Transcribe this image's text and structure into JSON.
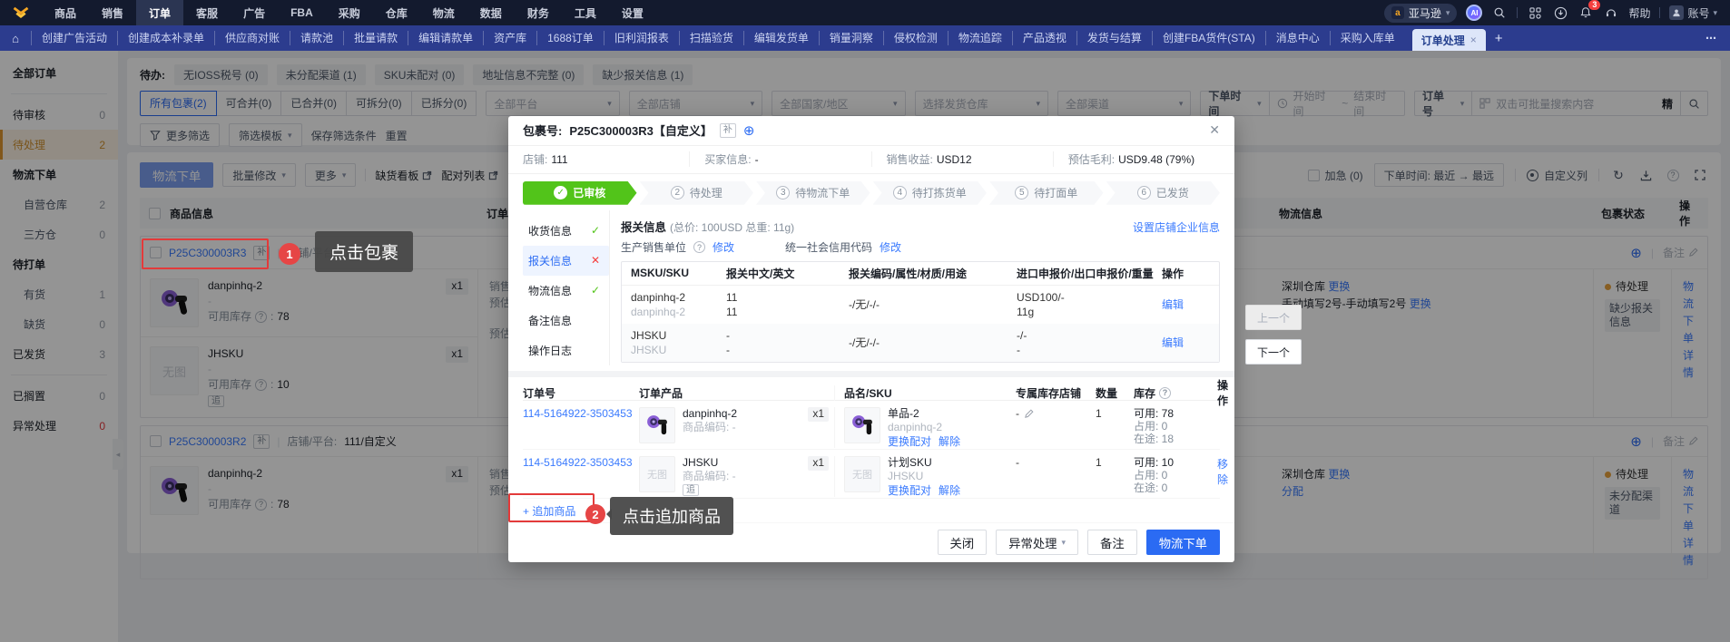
{
  "colors": {
    "accent": "#2b6bf3",
    "nav_dark": "#131a2e",
    "nav_blue": "#2c3c8e",
    "orange": "#e0962e",
    "green": "#52c41a",
    "red": "#e5383b",
    "link": "#3a7afe"
  },
  "topnav": {
    "menus": [
      "商品",
      "销售",
      "订单",
      "客服",
      "广告",
      "FBA",
      "采购",
      "仓库",
      "物流",
      "数据",
      "财务",
      "工具",
      "设置"
    ],
    "marketplace": "亚马逊",
    "ai": "AI",
    "badge": "3",
    "help": "帮助",
    "account": "账号"
  },
  "tabbar": {
    "items": [
      "创建广告活动",
      "创建成本补录单",
      "供应商对账",
      "请款池",
      "批量请款",
      "编辑请款单",
      "资产库",
      "1688订单",
      "旧利润报表",
      "扫描验货",
      "编辑发货单",
      "销量洞察",
      "侵权检测",
      "物流追踪",
      "产品透视",
      "发货与结算",
      "创建FBA货件(STA)",
      "消息中心",
      "采购入库单"
    ],
    "active": "订单处理"
  },
  "sidebar": {
    "all": "全部订单",
    "items": [
      {
        "label": "待审核",
        "count": "0"
      },
      {
        "label": "待处理",
        "count": "2"
      },
      {
        "label": "物流下单",
        "count": ""
      },
      {
        "label": "自营仓库",
        "count": "2"
      },
      {
        "label": "三方仓",
        "count": "0"
      },
      {
        "label": "待打单",
        "count": ""
      },
      {
        "label": "有货",
        "count": "1"
      },
      {
        "label": "缺货",
        "count": "0"
      },
      {
        "label": "已发货",
        "count": "3"
      },
      {
        "label": "已搁置",
        "count": "0"
      },
      {
        "label": "异常处理",
        "count": "0"
      }
    ]
  },
  "filters": {
    "todo_label": "待办:",
    "chips": [
      "无IOSS税号 (0)",
      "未分配渠道 (1)",
      "SKU未配对 (0)",
      "地址信息不完整 (0)",
      "缺少报关信息 (1)"
    ],
    "tabs": [
      "所有包裹(2)",
      "可合并(0)",
      "已合并(0)",
      "可拆分(0)",
      "已拆分(0)"
    ],
    "selects": [
      "全部平台",
      "全部店铺",
      "全部国家/地区",
      "选择发货仓库",
      "全部渠道"
    ],
    "time_field": "下单时间",
    "time_start": "开始时间",
    "time_sep": "~",
    "time_end": "结束时间",
    "search_field": "订单号",
    "search_placeholder": "双击可批量搜索内容",
    "exact": "精",
    "more": "更多筛选",
    "template": "筛选模板",
    "save": "保存筛选条件",
    "reset": "重置"
  },
  "toolbar": {
    "ship": "物流下单",
    "batch": "批量修改",
    "more": "更多",
    "oos": "缺货看板",
    "pair": "配对列表",
    "urgent": "加急 (0)",
    "sort": "下单时间: 最近 → 最远",
    "columns": "自定义列"
  },
  "list": {
    "headers": {
      "product": "商品信息",
      "amount": "订单金",
      "logistics": "物流信息",
      "status": "包裹状态",
      "action": "操作"
    },
    "note": "备注",
    "no_image": "无图",
    "groups": [
      {
        "pkg": "P25C300003R3",
        "tag": "补",
        "store_label": "店铺/平台:",
        "store": "111/自定义",
        "products": [
          {
            "name": "danpinhq-2",
            "sub": "-",
            "stock_label": "可用库存",
            "stock": "78",
            "qty": "x1"
          },
          {
            "name": "JHSKU",
            "sub": "-",
            "stock_label": "可用库存",
            "stock": "10",
            "qty": "x1",
            "tag": "追"
          }
        ],
        "amount_lines": [
          "销售收",
          "预估毛",
          "预估运"
        ],
        "wh": "深圳仓库",
        "wh_link": "更换",
        "channel": "手动填写2号-手动填写2号",
        "channel_link": "更换",
        "status": "待处理",
        "chip": "缺少报关信息",
        "act1": "物流下单",
        "act2": "详情"
      },
      {
        "pkg": "P25C300003R2",
        "tag": "补",
        "store_label": "店铺/平台:",
        "store": "111/自定义",
        "products": [
          {
            "name": "danpinhq-2",
            "sub": "-",
            "stock_label": "可用库存",
            "stock": "78",
            "qty": "x1"
          }
        ],
        "amount_lines": [
          "销售收",
          "预估毛"
        ],
        "wh": "深圳仓库",
        "wh_link": "更换",
        "channel": "",
        "channel_link": "分配",
        "status": "待处理",
        "chip": "未分配渠道",
        "act1": "物流下单",
        "act2": "详情"
      }
    ]
  },
  "modal": {
    "title_label": "包裹号:",
    "title": "P25C300003R3【自定义】",
    "tag": "补",
    "info": [
      {
        "label": "店铺:",
        "value": "111"
      },
      {
        "label": "买家信息:",
        "value": "-"
      },
      {
        "label": "销售收益:",
        "value": "USD12"
      },
      {
        "label": "预估毛利:",
        "value": "USD9.48 (79%)"
      }
    ],
    "steps": [
      {
        "num": "",
        "label": "已审核"
      },
      {
        "num": "2",
        "label": "待处理"
      },
      {
        "num": "3",
        "label": "待物流下单"
      },
      {
        "num": "4",
        "label": "待打拣货单"
      },
      {
        "num": "5",
        "label": "待打面单"
      },
      {
        "num": "6",
        "label": "已发货"
      }
    ],
    "tabs": [
      "收货信息",
      "报关信息",
      "物流信息",
      "备注信息",
      "操作日志"
    ],
    "customs": {
      "title": "报关信息",
      "meta": "(总价: 100USD 总重: 11g)",
      "corp_link": "设置店铺企业信息",
      "unit": "生产销售单位",
      "edit": "修改",
      "credit": "统一社会信用代码",
      "edit2": "修改",
      "cols": [
        "MSKU/SKU",
        "报关中文/英文",
        "报关编码/属性/材质/用途",
        "进口申报价/出口申报价/重量",
        "操作"
      ],
      "rows": [
        {
          "a1": "danpinhq-2",
          "a2": "danpinhq-2",
          "b1": "11",
          "b2": "11",
          "c": "-/无/-/-",
          "d1": "USD100/-",
          "d2": "11g",
          "e": "编辑"
        },
        {
          "a1": "JHSKU",
          "a2": "JHSKU",
          "b1": "-",
          "b2": "-",
          "c": "-/无/-/-",
          "d1": "-/-",
          "d2": "-",
          "e": "编辑"
        }
      ]
    },
    "orders": {
      "cols": [
        "订单号",
        "订单产品",
        "品名/SKU",
        "专属库存店铺",
        "数量",
        "库存",
        "操作"
      ],
      "rows": [
        {
          "no": "114-5164922-3503453",
          "pname": "danpinhq-2",
          "pcode": "商品编码: -",
          "ptag": "",
          "qty": "x1",
          "sname": "单品-2",
          "ssub": "danpinhq-2",
          "l1": "更换配对",
          "l2": "解除",
          "store": "-",
          "count": "1",
          "s1": "可用: 78",
          "s2": "占用: 0",
          "s3": "在途: 18",
          "act": ""
        },
        {
          "no": "114-5164922-3503453",
          "pname": "JHSKU",
          "pcode": "商品编码: -",
          "ptag": "追",
          "qty": "x1",
          "sname": "计划SKU",
          "ssub": "JHSKU",
          "l1": "更换配对",
          "l2": "解除",
          "store": "-",
          "count": "1",
          "s1": "可用: 10",
          "s2": "占用: 0",
          "s3": "在途: 0",
          "act": "移除"
        }
      ]
    },
    "add": "+ 追加商品",
    "btn_close": "关闭",
    "btn_exception": "异常处理",
    "btn_note": "备注",
    "btn_ship": "物流下单",
    "prev": "上一个",
    "next": "下一个"
  },
  "ann": {
    "n1": "1",
    "t1": "点击包裹",
    "n2": "2",
    "t2": "点击追加商品"
  }
}
